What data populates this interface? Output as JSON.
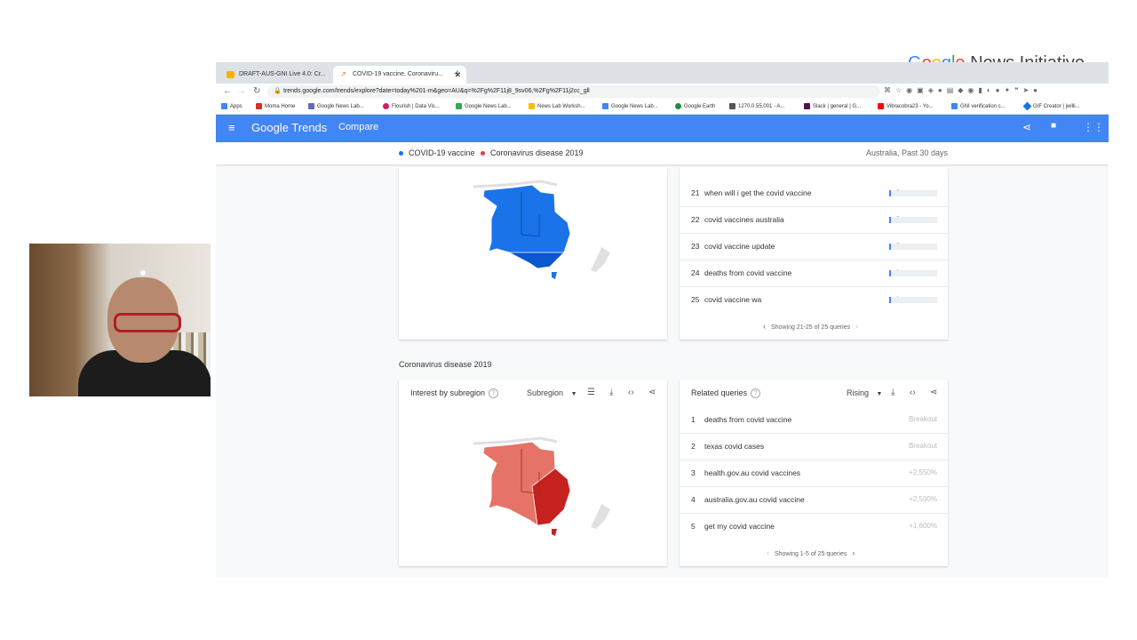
{
  "brand": {
    "parts": [
      "G",
      "o",
      "o",
      "g",
      "l",
      "e"
    ],
    "suffix": " News Initiative"
  },
  "browser": {
    "tabs": [
      {
        "title": "DRAFT-AUS-GNI Live 4.0: Cr...",
        "active": false
      },
      {
        "title": "COVID-19 vaccine, Coronaviru...",
        "active": true
      }
    ],
    "url": "trends.google.com/trends/explore?date=today%201-m&geo=AU&q=%2Fg%2F11j8_9sv06,%2Fg%2F11j2cc_gll",
    "bookmarks": [
      "Apps",
      "Moma Home",
      "Google News Lab...",
      "Flourish | Data Vis...",
      "Google News Lab...",
      "News Lab Worksh...",
      "Google News Lab...",
      "Google Earth",
      "1270.0.55.001 - A...",
      "Slack | general | G...",
      "Vibracobra23 - Yo...",
      "GNI verification c...",
      "GIF Creator | jwilli..."
    ]
  },
  "trends": {
    "logo": "Google Trends",
    "compare": "Compare",
    "legend": [
      {
        "label": "COVID-19 vaccine",
        "color": "#1a73e8"
      },
      {
        "label": "Coronavirus disease 2019",
        "color": "#db4437"
      }
    ],
    "geo_time": "Australia, Past 30 days",
    "top_queries": [
      {
        "num": "21",
        "text": "when will i get the covid vaccine",
        "value": "2",
        "fill": 0.02
      },
      {
        "num": "22",
        "text": "covid vaccines australia",
        "value": "2",
        "fill": 0.02
      },
      {
        "num": "23",
        "text": "covid vaccine update",
        "value": "2",
        "fill": 0.02
      },
      {
        "num": "24",
        "text": "deaths from covid vaccine",
        "value": "1",
        "fill": 0.01
      },
      {
        "num": "25",
        "text": "covid vaccine wa",
        "value": "1",
        "fill": 0.01
      }
    ],
    "top_pager": "Showing 21-25 of 25 queries",
    "section2_title": "Coronavirus disease 2019",
    "interest_title": "Interest by subregion",
    "subregion_select": "Subregion",
    "related_title": "Related queries",
    "rising_select": "Rising",
    "rising_queries": [
      {
        "num": "1",
        "text": "deaths from covid vaccine",
        "value": "Breakout"
      },
      {
        "num": "2",
        "text": "texas covid cases",
        "value": "Breakout"
      },
      {
        "num": "3",
        "text": "health.gov.au covid vaccines",
        "value": "+2,550%"
      },
      {
        "num": "4",
        "text": "australia.gov.au covid vaccine",
        "value": "+2,500%"
      },
      {
        "num": "5",
        "text": "get my covid vaccine",
        "value": "+1,600%"
      }
    ],
    "bottom_pager": "Showing 1-5 of 25 queries"
  }
}
